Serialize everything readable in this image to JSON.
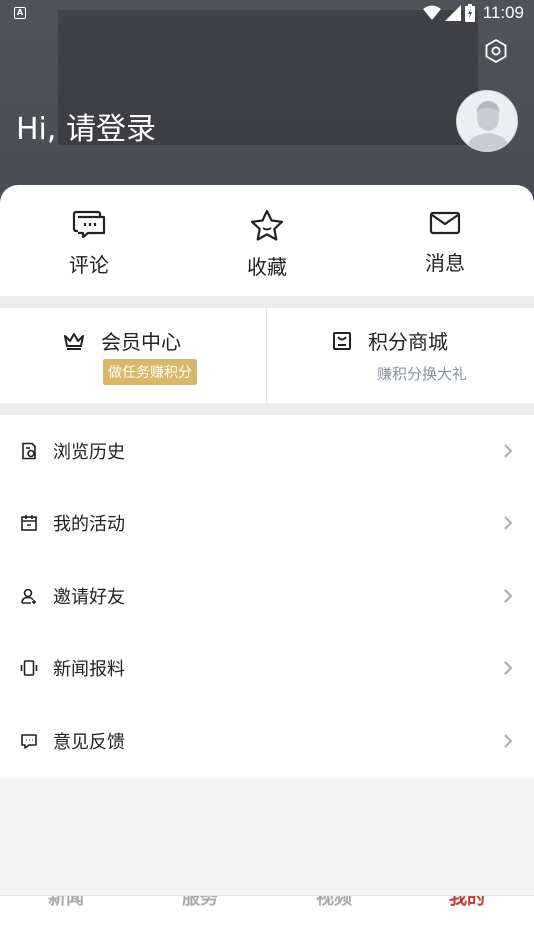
{
  "status_bar": {
    "time": "11:09",
    "left_badge": "A"
  },
  "header": {
    "greeting": "Hi, 请登录",
    "settings_icon": "settings-hexagon-icon",
    "avatar_icon": "default-avatar-icon"
  },
  "quick_actions": [
    {
      "label": "评论",
      "icon": "comment-icon"
    },
    {
      "label": "收藏",
      "icon": "star-icon"
    },
    {
      "label": "消息",
      "icon": "mail-icon"
    }
  ],
  "member": {
    "center_label": "会员中心",
    "center_badge": "做任务赚积分",
    "mall_label": "积分商城",
    "mall_sub": "赚积分换大礼"
  },
  "menu": [
    {
      "label": "浏览历史",
      "icon": "history-icon"
    },
    {
      "label": "我的活动",
      "icon": "calendar-icon"
    },
    {
      "label": "邀请好友",
      "icon": "invite-user-icon"
    },
    {
      "label": "新闻报料",
      "icon": "news-tip-icon"
    },
    {
      "label": "意见反馈",
      "icon": "feedback-icon"
    }
  ],
  "tabs": [
    {
      "label": "新闻"
    },
    {
      "label": "服务"
    },
    {
      "label": "视频"
    },
    {
      "label": "我的"
    }
  ],
  "colors": {
    "accent": "#c43a32",
    "badge": "#d8b867",
    "header_bg": "#4a4d54"
  }
}
